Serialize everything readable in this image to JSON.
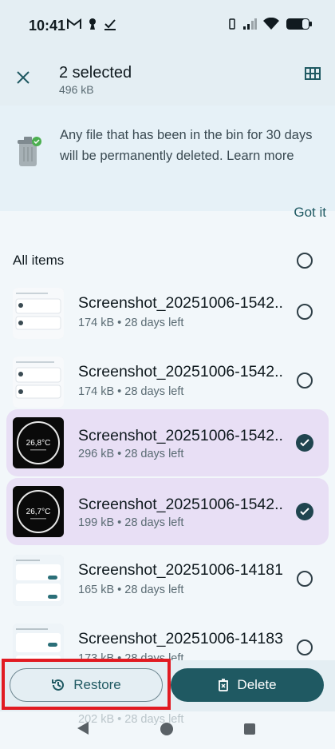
{
  "status": {
    "time": "10:41",
    "icons": [
      "gmail-icon",
      "keyhole-icon",
      "check-download-icon"
    ],
    "right_icons": [
      "vibrate-icon",
      "signal-icon",
      "wifi-icon",
      "battery-icon"
    ]
  },
  "header": {
    "title": "2 selected",
    "size": "496 kB"
  },
  "banner": {
    "text": "Any file that has been in the bin for 30 days will be permanently deleted. Learn more",
    "action": "Got it"
  },
  "list": {
    "all_label": "All items",
    "items": [
      {
        "title": "Screenshot_20251006-1542...",
        "subtitle": "174 kB • 28 days left",
        "selected": false,
        "thumb": "light",
        "thumb_label": ""
      },
      {
        "title": "Screenshot_20251006-1542...",
        "subtitle": "174 kB • 28 days left",
        "selected": false,
        "thumb": "light",
        "thumb_label": ""
      },
      {
        "title": "Screenshot_20251006-1542...",
        "subtitle": "296 kB • 28 days left",
        "selected": true,
        "thumb": "dark",
        "thumb_label": "26,8°C"
      },
      {
        "title": "Screenshot_20251006-1542...",
        "subtitle": "199 kB • 28 days left",
        "selected": true,
        "thumb": "dark",
        "thumb_label": "26,7°C"
      },
      {
        "title": "Screenshot_20251006-14181...",
        "subtitle": "165 kB • 28 days left",
        "selected": false,
        "thumb": "settings",
        "thumb_label": ""
      },
      {
        "title": "Screenshot_20251006-14183...",
        "subtitle": "173 kB • 28 days left",
        "selected": false,
        "thumb": "settings",
        "thumb_label": ""
      }
    ],
    "partial_subtitle": "202 kB • 28 days left"
  },
  "actions": {
    "restore": "Restore",
    "delete": "Delete"
  },
  "colors": {
    "accent": "#1f5962",
    "selected_bg": "#e8dff5",
    "highlight": "#e11b22"
  }
}
